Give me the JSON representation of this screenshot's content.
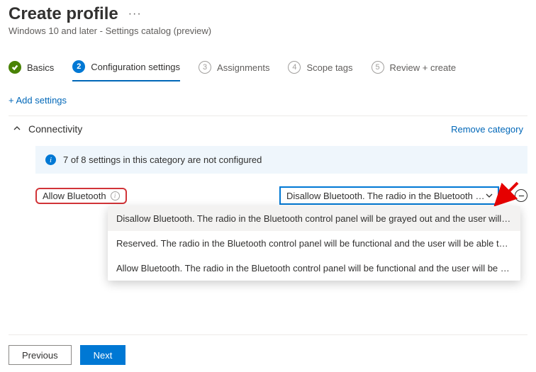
{
  "header": {
    "title": "Create profile",
    "more": "···",
    "subtitle": "Windows 10 and later - Settings catalog (preview)"
  },
  "wizard": {
    "steps": [
      {
        "num": "",
        "label": "Basics"
      },
      {
        "num": "2",
        "label": "Configuration settings"
      },
      {
        "num": "3",
        "label": "Assignments"
      },
      {
        "num": "4",
        "label": "Scope tags"
      },
      {
        "num": "5",
        "label": "Review + create"
      }
    ]
  },
  "add_settings": "+ Add settings",
  "category": {
    "name": "Connectivity",
    "remove": "Remove category",
    "info": "7 of 8 settings in this category are not configured"
  },
  "setting": {
    "label": "Allow Bluetooth",
    "selected_display": "Disallow Bluetooth. The radio in the Bluetooth con…",
    "options": [
      "Disallow Bluetooth. The radio in the Bluetooth control panel will be grayed out and the user will not b…",
      "Reserved. The radio in the Bluetooth control panel will be functional and the user will be able to turn …",
      "Allow Bluetooth. The radio in the Bluetooth control panel will be functional and the user will be able t…"
    ]
  },
  "footer": {
    "previous": "Previous",
    "next": "Next"
  }
}
